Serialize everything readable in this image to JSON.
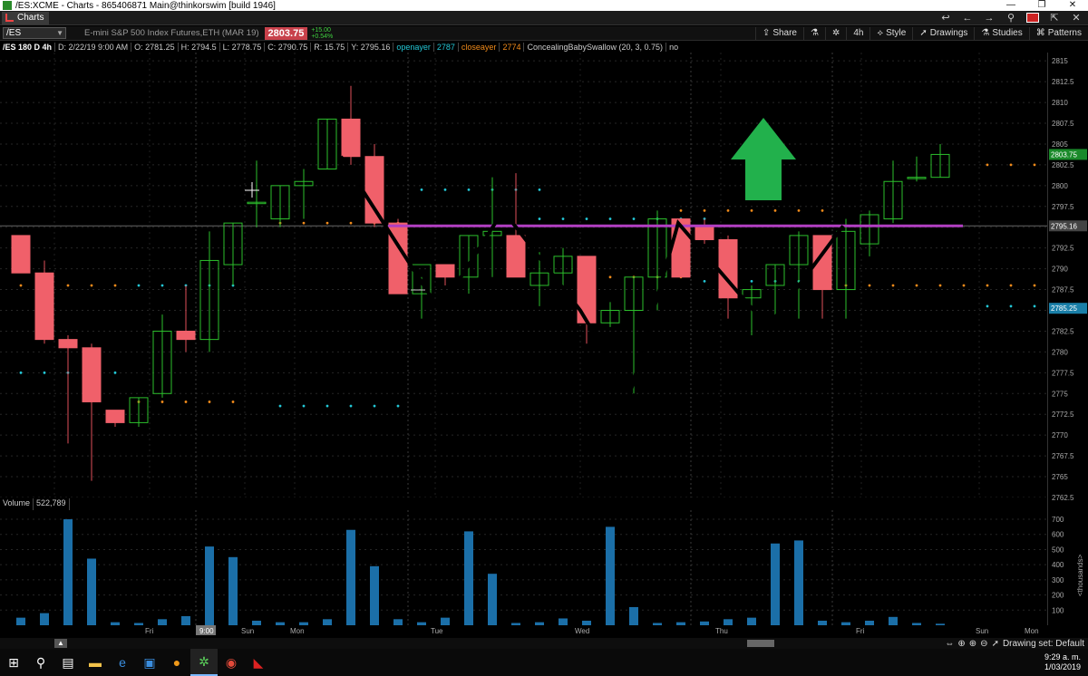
{
  "window": {
    "title": "/ES:XCME - Charts - 865406871 Main@thinkorswim [build 1946]",
    "controls": [
      "—",
      "❐",
      "✕"
    ]
  },
  "tabs": {
    "charts_label": "Charts",
    "right_icons": [
      "↩",
      "←",
      "→",
      "⚲",
      "▣",
      "⇱",
      "✕"
    ]
  },
  "toolbar": {
    "symbol": "/ES",
    "description": "E-mini S&P 500 Index Futures,ETH (MAR 19)",
    "last_price": "2803.75",
    "change_abs": "+15.00",
    "change_pct": "+0.54%",
    "share": "Share",
    "aggregation": "4h",
    "style": "Style",
    "drawings": "Drawings",
    "studies": "Studies",
    "patterns": "Patterns"
  },
  "info": {
    "symbol_period": "/ES 180 D 4h",
    "date": "D: 2/22/19 9:00 AM",
    "open": "O: 2781.25",
    "high": "H: 2794.5",
    "low": "L: 2778.75",
    "close": "C: 2790.75",
    "range": "R: 15.75",
    "y": "Y: 2795.16",
    "study1_name": "openayer",
    "study1_val": "2787",
    "study2_name": "closeayer",
    "study2_val": "2774",
    "study3": "ConcealingBabySwallow (20, 3, 0.75)",
    "study3_flag": "no"
  },
  "volume": {
    "label": "Volume",
    "value": "522,789",
    "unit_label": "<thousands>"
  },
  "axis": {
    "price_ticks": [
      "2815",
      "2812.5",
      "2810",
      "2807.5",
      "2805",
      "2802.5",
      "2800",
      "2797.5",
      "2795",
      "2792.5",
      "2790",
      "2787.5",
      "2785",
      "2782.5",
      "2780",
      "2777.5",
      "2775",
      "2772.5",
      "2770",
      "2767.5",
      "2765",
      "2762.5"
    ],
    "volume_ticks": [
      "700",
      "600",
      "500",
      "400",
      "300",
      "200",
      "100"
    ],
    "price_tags": [
      {
        "text": "2803.75",
        "color": "#1a8a2a"
      },
      {
        "text": "2795.16",
        "color": "#444444"
      },
      {
        "text": "2785.25",
        "color": "#1a7fa8"
      }
    ],
    "x_labels": [
      "Fri",
      "9:00",
      "Sun",
      "Mon",
      "Tue",
      "Wed",
      "Thu",
      "Fri",
      "Sun",
      "Mon"
    ]
  },
  "status": {
    "drawing_set": "Drawing set: Default"
  },
  "taskbar": {
    "time": "9:29 a. m.",
    "date": "1/03/2019"
  },
  "chart_data": {
    "type": "candlestick",
    "title": "/ES 180 D 4h",
    "ylim": [
      2762.5,
      2816
    ],
    "candles": [
      {
        "o": 2794,
        "h": 2794,
        "l": 2789.5,
        "c": 2789.5
      },
      {
        "o": 2789.5,
        "h": 2791,
        "l": 2781,
        "c": 2781.5
      },
      {
        "o": 2781.5,
        "h": 2782,
        "l": 2769,
        "c": 2780.5
      },
      {
        "o": 2780.5,
        "h": 2781,
        "l": 2764.5,
        "c": 2774
      },
      {
        "o": 2773,
        "h": 2773,
        "l": 2771,
        "c": 2771.5
      },
      {
        "o": 2771.5,
        "h": 2774.5,
        "l": 2771,
        "c": 2774.5
      },
      {
        "o": 2775,
        "h": 2784.5,
        "l": 2774.5,
        "c": 2782.5
      },
      {
        "o": 2782.5,
        "h": 2788,
        "l": 2780,
        "c": 2781.5
      },
      {
        "o": 2781.5,
        "h": 2794.5,
        "l": 2780,
        "c": 2791
      },
      {
        "o": 2790.5,
        "h": 2795.5,
        "l": 2788,
        "c": 2795.5
      },
      {
        "o": 2798,
        "h": 2803,
        "l": 2795,
        "c": 2798
      },
      {
        "o": 2796,
        "h": 2800,
        "l": 2795,
        "c": 2800
      },
      {
        "o": 2800,
        "h": 2802,
        "l": 2796,
        "c": 2800.5
      },
      {
        "o": 2802,
        "h": 2808,
        "l": 2802,
        "c": 2808
      },
      {
        "o": 2808,
        "h": 2812,
        "l": 2802.5,
        "c": 2803.5
      },
      {
        "o": 2803.5,
        "h": 2805,
        "l": 2795,
        "c": 2795.5
      },
      {
        "o": 2795.5,
        "h": 2796,
        "l": 2787,
        "c": 2787
      },
      {
        "o": 2787,
        "h": 2789,
        "l": 2784,
        "c": 2790.5
      },
      {
        "o": 2790.5,
        "h": 2790.5,
        "l": 2788,
        "c": 2789
      },
      {
        "o": 2789,
        "h": 2794,
        "l": 2787,
        "c": 2794
      },
      {
        "o": 2794,
        "h": 2801,
        "l": 2789,
        "c": 2794.5
      },
      {
        "o": 2794,
        "h": 2801.5,
        "l": 2789,
        "c": 2789
      },
      {
        "o": 2788,
        "h": 2792,
        "l": 2785.5,
        "c": 2789.5
      },
      {
        "o": 2789.5,
        "h": 2792.5,
        "l": 2787.5,
        "c": 2791.5
      },
      {
        "o": 2791.5,
        "h": 2791.5,
        "l": 2781,
        "c": 2783.5
      },
      {
        "o": 2783.5,
        "h": 2786,
        "l": 2783,
        "c": 2785
      },
      {
        "o": 2785,
        "h": 2789,
        "l": 2775,
        "c": 2789
      },
      {
        "o": 2789,
        "h": 2797,
        "l": 2785,
        "c": 2796
      },
      {
        "o": 2796,
        "h": 2796,
        "l": 2789,
        "c": 2789
      },
      {
        "o": 2795,
        "h": 2796,
        "l": 2793,
        "c": 2793.5
      },
      {
        "o": 2793.5,
        "h": 2794,
        "l": 2784,
        "c": 2786.5
      },
      {
        "o": 2786.5,
        "h": 2788,
        "l": 2782,
        "c": 2787.5
      },
      {
        "o": 2788,
        "h": 2790.5,
        "l": 2784,
        "c": 2790.5
      },
      {
        "o": 2790.5,
        "h": 2794.5,
        "l": 2784,
        "c": 2794
      },
      {
        "o": 2794,
        "h": 2794,
        "l": 2784,
        "c": 2787.5
      },
      {
        "o": 2787.5,
        "h": 2796,
        "l": 2784,
        "c": 2794.5
      },
      {
        "o": 2793,
        "h": 2797,
        "l": 2791.5,
        "c": 2796.5
      },
      {
        "o": 2796,
        "h": 2803,
        "l": 2795.5,
        "c": 2800.5
      },
      {
        "o": 2801,
        "h": 2803.5,
        "l": 2800.5,
        "c": 2801
      },
      {
        "o": 2801,
        "h": 2805,
        "l": 2801,
        "c": 2803.75
      }
    ],
    "volume": [
      50,
      80,
      700,
      440,
      20,
      15,
      40,
      60,
      520,
      450,
      30,
      20,
      20,
      40,
      630,
      390,
      40,
      20,
      50,
      620,
      340,
      15,
      20,
      45,
      30,
      650,
      120,
      15,
      20,
      25,
      40,
      50,
      540,
      560,
      30,
      20,
      30,
      55,
      15,
      10
    ],
    "horizontal_line": 2795.16,
    "zigzag": [
      2803.5,
      2785,
      2797,
      2785,
      2775,
      2795.5,
      2783,
      2795.16
    ]
  }
}
